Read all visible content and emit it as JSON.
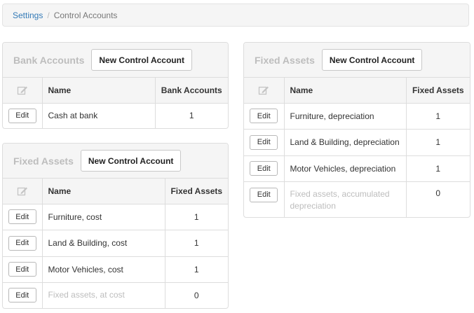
{
  "breadcrumb": {
    "link": "Settings",
    "separator": "/",
    "current": "Control Accounts"
  },
  "bank_panel": {
    "title": "Bank Accounts",
    "new_button": "New Control Account",
    "columns": {
      "name": "Name",
      "count": "Bank Accounts"
    },
    "rows": [
      {
        "edit": "Edit",
        "name": "Cash at bank",
        "count": "1"
      }
    ]
  },
  "fixed_assets_cost_panel": {
    "title": "Fixed Assets",
    "new_button": "New Control Account",
    "columns": {
      "name": "Name",
      "count": "Fixed Assets"
    },
    "rows": [
      {
        "edit": "Edit",
        "name": "Furniture, cost",
        "count": "1"
      },
      {
        "edit": "Edit",
        "name": "Land & Building, cost",
        "count": "1"
      },
      {
        "edit": "Edit",
        "name": "Motor Vehicles, cost",
        "count": "1"
      },
      {
        "edit": "Edit",
        "name": "Fixed assets, at cost",
        "count": "0"
      }
    ]
  },
  "fixed_assets_depr_panel": {
    "title": "Fixed Assets",
    "new_button": "New Control Account",
    "columns": {
      "name": "Name",
      "count": "Fixed Assets"
    },
    "rows": [
      {
        "edit": "Edit",
        "name": "Furniture, depreciation",
        "count": "1"
      },
      {
        "edit": "Edit",
        "name": "Land & Building, depreciation",
        "count": "1"
      },
      {
        "edit": "Edit",
        "name": "Motor Vehicles, depreciation",
        "count": "1"
      },
      {
        "edit": "Edit",
        "name": "Fixed assets, accumulated depreciation",
        "count": "0"
      }
    ]
  },
  "colors": {
    "link": "#337ab7",
    "muted": "#bdbdbd",
    "panel_bg": "#f5f5f5",
    "border": "#dddddd"
  }
}
